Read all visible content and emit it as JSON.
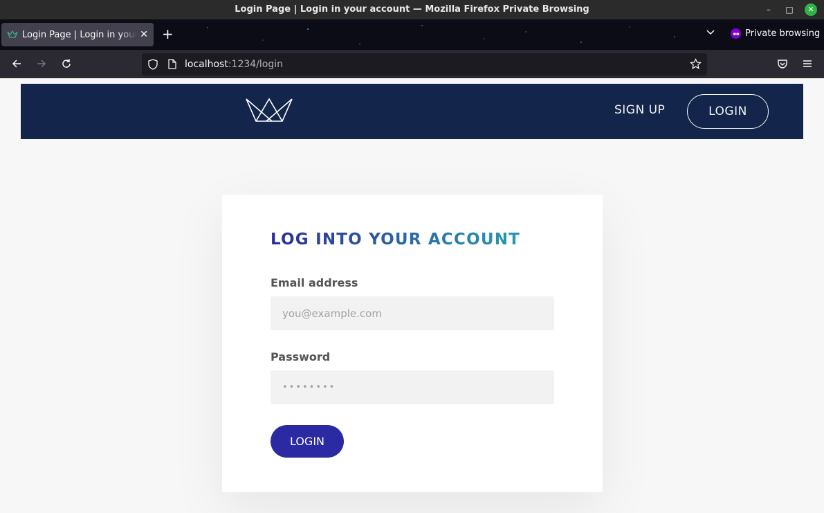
{
  "window": {
    "title": "Login Page | Login in your account — Mozilla Firefox Private Browsing"
  },
  "tabs": [
    {
      "title": "Login Page | Login in your account"
    }
  ],
  "private_label": "Private browsing",
  "url": {
    "host": "localhost",
    "path": ":1234/login"
  },
  "site_nav": {
    "signup_label": "SIGN UP",
    "login_label": "LOGIN"
  },
  "form": {
    "heading": "LOG INTO YOUR ACCOUNT",
    "email_label": "Email address",
    "email_placeholder": "you@example.com",
    "password_label": "Password",
    "password_value": "••••••••",
    "submit_label": "LOGIN"
  },
  "colors": {
    "header_bg": "#13254b",
    "accent_button": "#2b2aa3",
    "heading_gradient_start": "#2d2c94",
    "heading_gradient_end": "#279ab3"
  }
}
